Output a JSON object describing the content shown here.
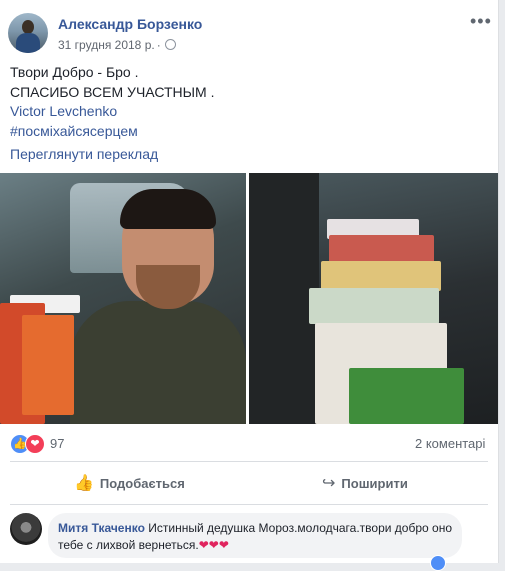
{
  "post": {
    "author": "Александр Борзенко",
    "date": "31 грудня 2018 р.",
    "privacy_icon": "globe-icon",
    "lines": [
      "Твори Добро - Бро .",
      "СПАСИБО ВСЕМ УЧАСТНЫМ ."
    ],
    "mention": "Victor Levchenko",
    "hashtag": "#посміхайсясерцем",
    "translate_link": "Переглянути переклад"
  },
  "reactions": {
    "count": "97",
    "comments": "2 коментарі"
  },
  "actions": {
    "like": "Подобається",
    "share": "Поширити"
  },
  "comment": {
    "author": "Митя Ткаченко",
    "text": "Истинный дедушка Мороз.молодчага.твори добро оно тебе с лихвой вернеться.",
    "hearts": "❤❤❤"
  },
  "colors": {
    "link": "#385898",
    "like_blue": "#4f8ef7",
    "love_red": "#f33e58"
  }
}
